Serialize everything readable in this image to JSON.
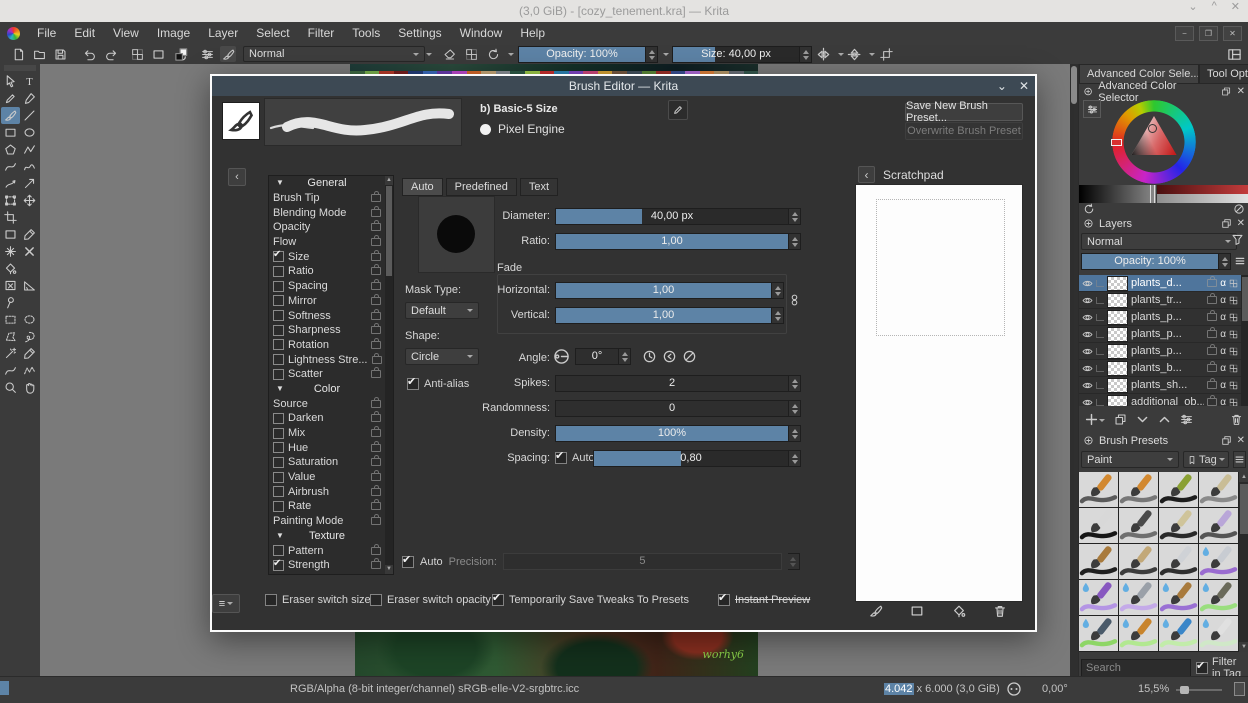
{
  "window": {
    "title": "(3,0 GiB) - [cozy_tenement.kra] — Krita"
  },
  "icons": {
    "alpha": "α",
    "menu": "≡",
    "chevron_left": "‹",
    "chevron_down": "⌄",
    "caret_up": "^",
    "close": "✕",
    "minimize": "−",
    "maximize": "❐",
    "up_arrow": "▲",
    "down_arrow": "▼"
  },
  "colors": {
    "accent": "#5d83a6",
    "dialog_titlebar": "#3d4954",
    "selection": "#4f759c"
  },
  "menu": {
    "items": [
      "File",
      "Edit",
      "View",
      "Image",
      "Layer",
      "Select",
      "Filter",
      "Tools",
      "Settings",
      "Window",
      "Help"
    ]
  },
  "toolbar": {
    "blending": "Normal",
    "opacity": {
      "label": "Opacity: 100%",
      "fill": "100%"
    },
    "size": {
      "label": "Size: 40,00 px",
      "fill": "33%"
    }
  },
  "toolbox": {
    "tools": [
      {
        "icon": "pointer",
        "name": "select-shapes-tool"
      },
      {
        "icon": "text",
        "name": "text-tool"
      },
      {
        "icon": "pen",
        "name": "edit-shapes-tool"
      },
      {
        "icon": "calligraphy",
        "name": "calligraphy-tool"
      },
      {
        "icon": "brush",
        "name": "freehand-brush-tool",
        "selected": true
      },
      {
        "icon": "line",
        "name": "line-tool"
      },
      {
        "icon": "rect",
        "name": "rectangle-tool"
      },
      {
        "icon": "ellipse",
        "name": "ellipse-tool"
      },
      {
        "icon": "polygon",
        "name": "polygon-tool"
      },
      {
        "icon": "polyline",
        "name": "polyline-tool"
      },
      {
        "icon": "curve",
        "name": "bezier-curve-tool"
      },
      {
        "icon": "freepath",
        "name": "freehand-path-tool"
      },
      {
        "icon": "dyn",
        "name": "dynamic-brush-tool"
      },
      {
        "icon": "multi",
        "name": "multibrush-tool"
      },
      {
        "icon": "transform",
        "name": "transform-tool"
      },
      {
        "icon": "move",
        "name": "move-tool"
      },
      {
        "icon": "crop",
        "name": "crop-tool"
      },
      {
        "icon": "none",
        "name": "toolbox-spacer"
      },
      {
        "icon": "gradient",
        "name": "gradient-tool"
      },
      {
        "icon": "dropper",
        "name": "color-sampler-tool"
      },
      {
        "icon": "patch",
        "name": "smart-patch-tool"
      },
      {
        "icon": "xmark",
        "name": "colorize-mask-tool"
      },
      {
        "icon": "fill",
        "name": "fill-tool"
      },
      {
        "icon": "none",
        "name": "toolbox-spacer"
      },
      {
        "icon": "enclose",
        "name": "enclose-fill-tool"
      },
      {
        "icon": "measure",
        "name": "measure-tool"
      },
      {
        "icon": "pin",
        "name": "reference-images-tool"
      },
      {
        "icon": "none",
        "name": "toolbox-spacer"
      },
      {
        "icon": "selrect",
        "name": "rectangular-selection-tool"
      },
      {
        "icon": "selellipse",
        "name": "elliptical-selection-tool"
      },
      {
        "icon": "selpoly",
        "name": "polygonal-selection-tool"
      },
      {
        "icon": "lasso",
        "name": "freehand-selection-tool"
      },
      {
        "icon": "wand",
        "name": "similar-color-selection-tool"
      },
      {
        "icon": "dropper",
        "name": "contiguous-selection-tool"
      },
      {
        "icon": "curve",
        "name": "bezier-selection-tool"
      },
      {
        "icon": "magnetic",
        "name": "magnetic-selection-tool"
      },
      {
        "icon": "zoom",
        "name": "zoom-tool"
      },
      {
        "icon": "hand",
        "name": "pan-tool"
      }
    ]
  },
  "artwork": {
    "signature": "worhy6",
    "palette": [
      "#3f6b43",
      "#7bb24e",
      "#b93b2a",
      "#7c1f1f",
      "#243e7c",
      "#3c6cc0",
      "#6a3bb0",
      "#c04ad0",
      "#d86a2c",
      "#c8a878",
      "#8a8f96",
      "#2d5a46",
      "#9ecb49",
      "#cc2f2f",
      "#2e86b8",
      "#8246c8",
      "#d1487e",
      "#d8a436",
      "#7a5a40",
      "#44525e",
      "#5c8a38",
      "#a03028",
      "#3a4f94",
      "#b06ad8",
      "#e0823c",
      "#b89a6a",
      "#6a7078",
      "#365a50"
    ]
  },
  "dialog": {
    "title": "Brush Editor — Krita",
    "preset_name": "b) Basic-5 Size",
    "engine": "Pixel Engine",
    "save_new_label": "Save New Brush Preset...",
    "overwrite_label": "Overwrite Brush Preset",
    "tabs": [
      {
        "label": "Auto",
        "selected": true
      },
      {
        "label": "Predefined"
      },
      {
        "label": "Text"
      }
    ],
    "options": [
      {
        "h": true,
        "label": "General"
      },
      {
        "label": "Brush Tip"
      },
      {
        "label": "Blending Mode"
      },
      {
        "label": "Opacity"
      },
      {
        "label": "Flow"
      },
      {
        "cb": true,
        "on": true,
        "label": "Size"
      },
      {
        "cb": true,
        "label": "Ratio"
      },
      {
        "cb": true,
        "label": "Spacing"
      },
      {
        "cb": true,
        "label": "Mirror"
      },
      {
        "cb": true,
        "label": "Softness"
      },
      {
        "cb": true,
        "label": "Sharpness"
      },
      {
        "cb": true,
        "label": "Rotation"
      },
      {
        "cb": true,
        "label": "Lightness Stre..."
      },
      {
        "cb": true,
        "label": "Scatter"
      },
      {
        "h": true,
        "label": "Color"
      },
      {
        "label": "Source"
      },
      {
        "cb": true,
        "label": "Darken"
      },
      {
        "cb": true,
        "label": "Mix"
      },
      {
        "cb": true,
        "label": "Hue"
      },
      {
        "cb": true,
        "label": "Saturation"
      },
      {
        "cb": true,
        "label": "Value"
      },
      {
        "cb": true,
        "label": "Airbrush"
      },
      {
        "cb": true,
        "label": "Rate"
      },
      {
        "label": "Painting Mode"
      },
      {
        "h": true,
        "label": "Texture"
      },
      {
        "cb": true,
        "label": "Pattern"
      },
      {
        "cb": true,
        "on": true,
        "label": "Strength"
      }
    ],
    "params": {
      "diameter": {
        "label": "Diameter:",
        "value": "40,00 px",
        "fill": "37%"
      },
      "ratio": {
        "label": "Ratio:",
        "value": "1,00",
        "fill": "100%"
      },
      "fade_label": "Fade",
      "horizontal": {
        "label": "Horizontal:",
        "value": "1,00",
        "fill": "100%"
      },
      "vertical": {
        "label": "Vertical:",
        "value": "1,00",
        "fill": "100%"
      },
      "mask_type_label": "Mask Type:",
      "mask_type": "Default",
      "shape_label": "Shape:",
      "shape": "Circle",
      "angle_label": "Angle:",
      "angle_value": "0°",
      "antialias_label": "Anti-alias",
      "spikes": {
        "label": "Spikes:",
        "value": "2",
        "fill": "0%"
      },
      "randomness": {
        "label": "Randomness:",
        "value": "0",
        "fill": "0%"
      },
      "density": {
        "label": "Density:",
        "value": "100%",
        "fill": "100%"
      },
      "spacing": {
        "label": "Spacing:",
        "auto_label": "Auto",
        "value": "0,80",
        "fill": "45%"
      },
      "auto_label": "Auto",
      "precision_label": "Precision:",
      "precision_value": "5"
    },
    "footer": {
      "eraser_switch_size": "Eraser switch size",
      "eraser_switch_opacity": "Eraser switch opacity",
      "save_tweaks": "Temporarily Save Tweaks To Presets",
      "instant_preview": "Instant Preview"
    },
    "scratchpad_title": "Scratchpad"
  },
  "dockers": {
    "tabs": [
      {
        "label": "Advanced Color Sele...",
        "selected": true
      },
      {
        "label": "Tool Opt..."
      }
    ],
    "color_selector": {
      "title": "Advanced Color Selector"
    },
    "layers": {
      "title": "Layers",
      "blending": "Normal",
      "opacity": {
        "label": "Opacity: 100%",
        "fill": "100%"
      },
      "rows": [
        {
          "name": "plants_d...",
          "selected": true
        },
        {
          "name": "plants_tr..."
        },
        {
          "name": "plants_p..."
        },
        {
          "name": "plants_p..."
        },
        {
          "name": "plants_p..."
        },
        {
          "name": "plants_b..."
        },
        {
          "name": "plants_sh..."
        },
        {
          "name": "additional_ob..."
        }
      ]
    },
    "presets": {
      "title": "Brush Presets",
      "filter_value": "Paint",
      "tag_label": "Tag",
      "search_placeholder": "Search",
      "filter_in_tag_label": "Filter in Tag",
      "cells": [
        {
          "h": "#d2882f",
          "s": "#5a5a5a"
        },
        {
          "h": "#d2882f",
          "s": "#777777"
        },
        {
          "h": "#8aa032",
          "s": "#1d1d1d"
        },
        {
          "h": "#c9bd96",
          "s": "#8a8a8a"
        },
        {
          "h": "#d8d8d8",
          "s": "#161616"
        },
        {
          "h": "#4a4a4a",
          "s": "#6f6f6f"
        },
        {
          "h": "#cfc49a",
          "s": "#2a2a2a"
        },
        {
          "h": "#b9a6d8",
          "s": "#555555"
        },
        {
          "h": "#a87a3c",
          "s": "#1f1f1f"
        },
        {
          "h": "#c2a878",
          "s": "#3c3c3c"
        },
        {
          "h": "#cfd2d6",
          "s": "#2f2f2f"
        },
        {
          "h": "#c8ccd2",
          "s": "#9a6cd0",
          "drop": true
        },
        {
          "h": "#8858c0",
          "s": "#b494e4",
          "drop": true
        },
        {
          "h": "#9aa0a8",
          "s": "#c4aae8",
          "drop": true
        },
        {
          "h": "#a87a3c",
          "s": "#9a70d4",
          "drop": true
        },
        {
          "h": "#6a6a5a",
          "s": "#9ade7e",
          "drop": true
        },
        {
          "h": "#4a5a6a",
          "s": "#8ed666",
          "drop": true
        },
        {
          "h": "#c8842c",
          "s": "#b2e890",
          "drop": true
        },
        {
          "h": "#3a86c8",
          "s": "#c2ecaa",
          "drop": true
        },
        {
          "h": "#e0e0e0",
          "s": "#d0e8c8",
          "drop": true
        }
      ]
    }
  },
  "statusbar": {
    "colorspace": "RGB/Alpha (8-bit integer/channel)  sRGB-elle-V2-srgbtrc.icc",
    "dim_selected": "4.042",
    "dim_rest": " x 6.000 (3,0 GiB)",
    "rotation": "0,00°",
    "zoom": "15,5%"
  }
}
